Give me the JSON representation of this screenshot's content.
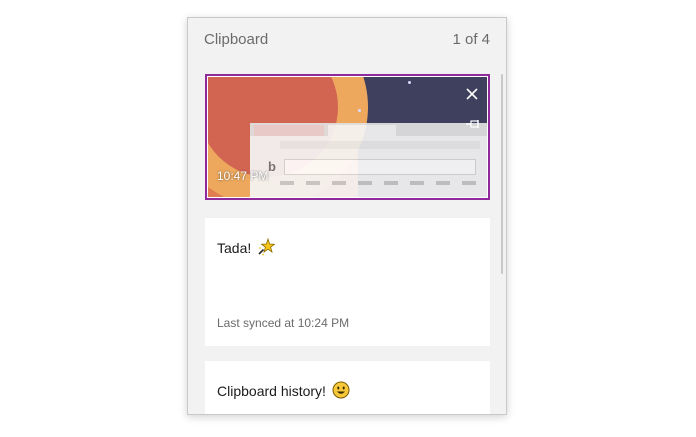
{
  "header": {
    "title": "Clipboard",
    "counter": "1 of 4"
  },
  "items": [
    {
      "type": "image",
      "time": "10:47 PM",
      "selected": true,
      "icons": [
        "close-icon",
        "pin-icon"
      ]
    },
    {
      "type": "text",
      "text": "Tada!",
      "emoji_icon": "sparkle-star-icon",
      "status": "Last synced at 10:24 PM"
    },
    {
      "type": "text",
      "text": "Clipboard history!",
      "emoji_icon": "smiley-face-icon"
    }
  ],
  "colors": {
    "selection_border": "#8e2a9a",
    "panel_bg": "#f2f2f2",
    "card_bg": "#ffffff",
    "muted_text": "#6b6b6b"
  }
}
